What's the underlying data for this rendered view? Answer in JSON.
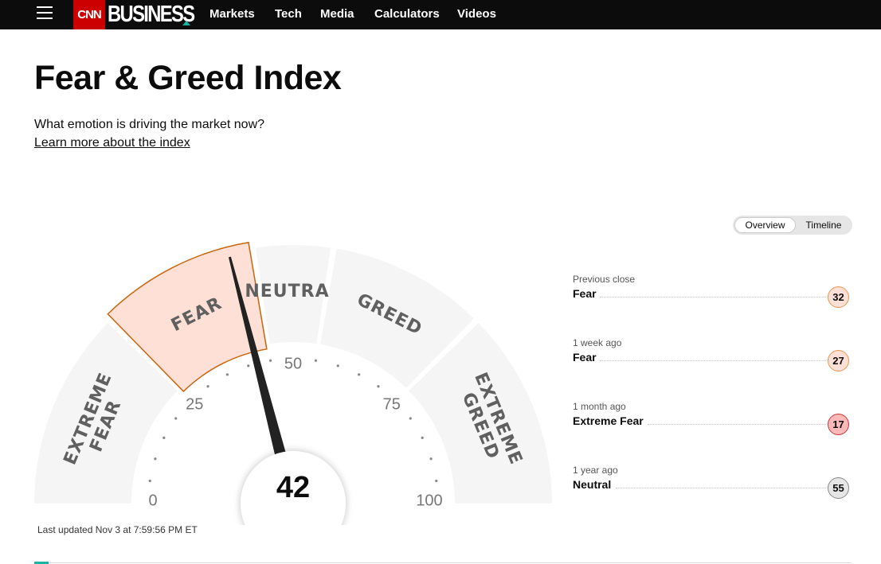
{
  "nav": {
    "logo": "CNN",
    "brand": "BUSINESS",
    "items": [
      "Markets",
      "Tech",
      "Media",
      "Calculators",
      "Videos"
    ]
  },
  "header": {
    "title": "Fear & Greed Index",
    "subtitle": "What emotion is driving the market now?",
    "learn_link": "Learn more about the index"
  },
  "view_toggle": {
    "options": [
      "Overview",
      "Timeline"
    ],
    "active": "Overview"
  },
  "gauge": {
    "value": 42,
    "segments": [
      {
        "label": "EXTREME FEAR",
        "lines": [
          "EXTREME",
          "FEAR"
        ],
        "from": 0,
        "to": 25,
        "active": false
      },
      {
        "label": "FEAR",
        "lines": [
          "FEAR"
        ],
        "from": 25,
        "to": 45,
        "active": true
      },
      {
        "label": "NEUTRAL",
        "lines": [
          "NEUTRAL"
        ],
        "from": 45,
        "to": 55,
        "active": false
      },
      {
        "label": "GREED",
        "lines": [
          "GREED"
        ],
        "from": 55,
        "to": 75,
        "active": false
      },
      {
        "label": "EXTREME GREED",
        "lines": [
          "EXTREME",
          "GREED"
        ],
        "from": 75,
        "to": 100,
        "active": false
      }
    ],
    "ticks": [
      "0",
      "25",
      "50",
      "75",
      "100"
    ],
    "colors": {
      "segment": "#f5f5f5",
      "active_fill": "#ffe0d6",
      "active_stroke": "#c8650e",
      "label": "#606060",
      "needle": "#222222"
    }
  },
  "last_updated": "Last updated Nov 3 at 7:59:56 PM ET",
  "history": [
    {
      "label": "Previous close",
      "rating": "Fear",
      "value": "32",
      "bg": "#ffe0d6",
      "border": "#e8964e"
    },
    {
      "label": "1 week ago",
      "rating": "Fear",
      "value": "27",
      "bg": "#ffe0d6",
      "border": "#e8964e"
    },
    {
      "label": "1 month ago",
      "rating": "Extreme Fear",
      "value": "17",
      "bg": "#ffb9b9",
      "border": "#cc3333"
    },
    {
      "label": "1 year ago",
      "rating": "Neutral",
      "value": "55",
      "bg": "#e6e6e6",
      "border": "#888888"
    }
  ]
}
